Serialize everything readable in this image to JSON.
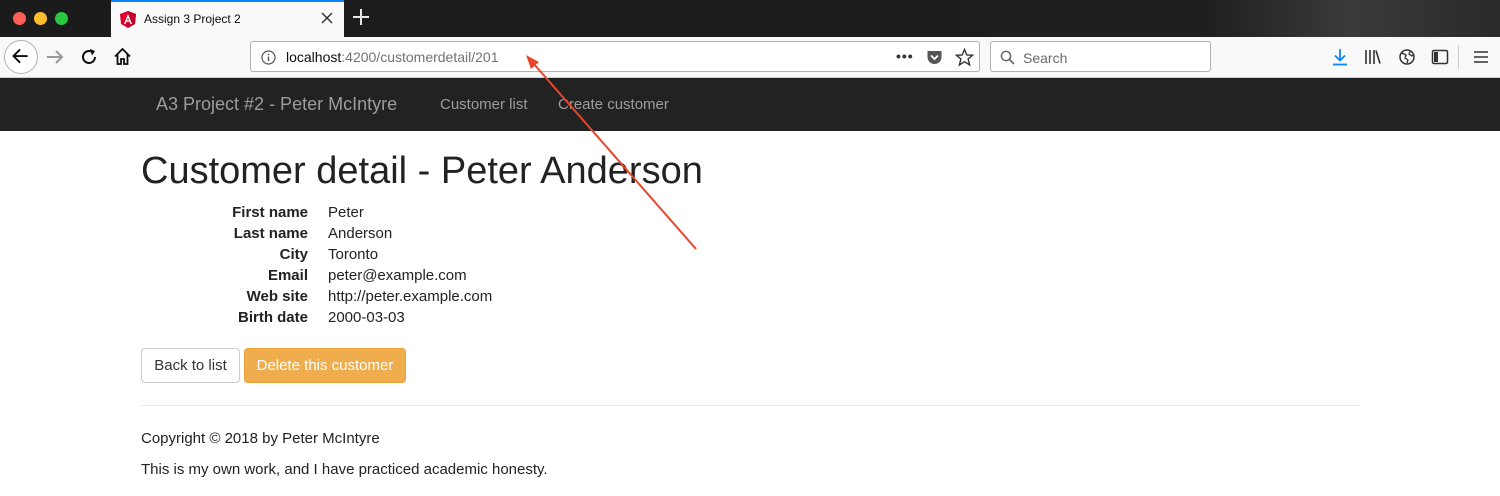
{
  "browser": {
    "tab_title": "Assign 3 Project 2",
    "url_host": "localhost",
    "url_rest": ":4200/customerdetail/201",
    "url_more": "•••",
    "search_placeholder": "Search"
  },
  "app": {
    "brand": "A3 Project #2 - Peter McIntyre",
    "nav": {
      "customer_list": "Customer list",
      "create_customer": "Create customer"
    }
  },
  "page": {
    "title": "Customer detail - Peter Anderson",
    "fields": [
      {
        "label": "First name",
        "value": "Peter"
      },
      {
        "label": "Last name",
        "value": "Anderson"
      },
      {
        "label": "City",
        "value": "Toronto"
      },
      {
        "label": "Email",
        "value": "peter@example.com"
      },
      {
        "label": "Web site",
        "value": "http://peter.example.com"
      },
      {
        "label": "Birth date",
        "value": "2000-03-03"
      }
    ],
    "back_button": "Back to list",
    "delete_button": "Delete this customer"
  },
  "footer": {
    "copyright": "Copyright © 2018 by Peter McIntyre",
    "honesty": "This is my own work, and I have practiced academic honesty."
  },
  "colors": {
    "app_nav_bg": "#222222",
    "delete_button": "#f0ad4e",
    "tab_accent": "#0a84ff",
    "annotation_arrow": "#e8452c"
  },
  "icons": [
    "angular-favicon-icon",
    "close-icon",
    "plus-icon",
    "back-arrow-icon",
    "forward-arrow-icon",
    "reload-icon",
    "home-icon",
    "info-icon",
    "pocket-icon",
    "star-icon",
    "search-icon",
    "download-icon",
    "library-icon",
    "globe-icon",
    "sidebar-icon",
    "hamburger-menu-icon"
  ]
}
